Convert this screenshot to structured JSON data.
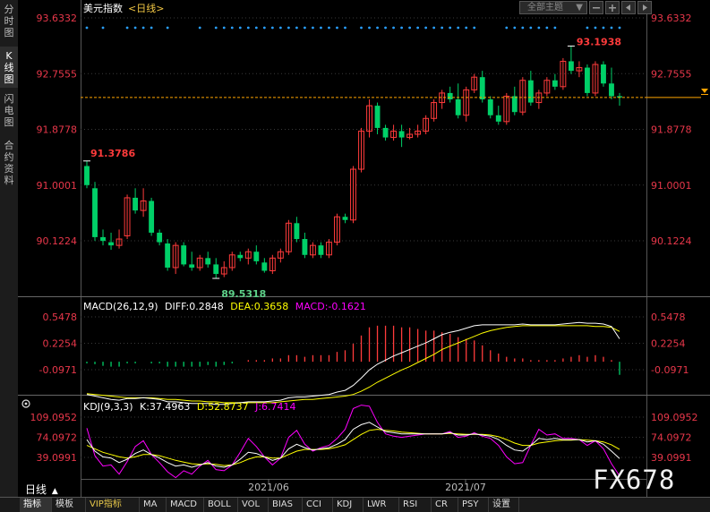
{
  "sidebar": {
    "items": [
      {
        "label": "分时图",
        "chars": [
          "分",
          "时",
          "图"
        ],
        "active": false
      },
      {
        "label": "K线图",
        "chars": [
          "K",
          "线",
          "图"
        ],
        "active": true
      },
      {
        "label": "闪电图",
        "chars": [
          "闪",
          "电",
          "图"
        ],
        "active": false
      },
      {
        "label": "合约资料",
        "chars": [
          "合",
          "约",
          "资",
          "料"
        ],
        "active": false
      }
    ]
  },
  "header": {
    "title": "美元指数",
    "period": "<日线>",
    "theme_select": "全部主题",
    "theme_arrow": "▼"
  },
  "colors": {
    "up": "#ff3b3b",
    "down": "#00d068",
    "axis_text": "#e8374a",
    "grid": "#444",
    "macd_axis_text": "#e8374a",
    "diff_line": "#ffffff",
    "dea_line": "#ffff00",
    "kdj_k": "#ffffff",
    "kdj_d": "#ffff00",
    "kdj_j": "#ff00ff",
    "dot_marks": "#2aa0ff",
    "price_line": "#ffa500"
  },
  "chart_data": [
    {
      "type": "candlestick",
      "title": "美元指数",
      "y_ticks": [
        "93.6332",
        "92.7555",
        "91.8778",
        "91.0001",
        "90.1224"
      ],
      "y_tick_values": [
        93.6332,
        92.7555,
        91.8778,
        91.0001,
        90.1224
      ],
      "ylim": [
        89.35,
        93.85
      ],
      "x_ticks": [
        "2021/06",
        "2021/07"
      ],
      "annotations": {
        "high_label": "93.1938",
        "low_label": "89.5318",
        "left_label": "91.3786"
      },
      "current_price": 92.38,
      "candles": [
        {
          "o": 91.3,
          "h": 91.38,
          "l": 90.95,
          "c": 91.0
        },
        {
          "o": 90.95,
          "h": 91.05,
          "l": 90.12,
          "c": 90.18
        },
        {
          "o": 90.18,
          "h": 90.3,
          "l": 90.05,
          "c": 90.12
        },
        {
          "o": 90.1,
          "h": 90.25,
          "l": 89.98,
          "c": 90.05
        },
        {
          "o": 90.05,
          "h": 90.3,
          "l": 90.0,
          "c": 90.15
        },
        {
          "o": 90.2,
          "h": 90.85,
          "l": 90.15,
          "c": 90.8
        },
        {
          "o": 90.8,
          "h": 90.95,
          "l": 90.55,
          "c": 90.6
        },
        {
          "o": 90.6,
          "h": 90.95,
          "l": 90.5,
          "c": 90.75
        },
        {
          "o": 90.75,
          "h": 90.8,
          "l": 90.2,
          "c": 90.25
        },
        {
          "o": 90.25,
          "h": 90.3,
          "l": 90.05,
          "c": 90.1
        },
        {
          "o": 90.08,
          "h": 90.15,
          "l": 89.65,
          "c": 89.7
        },
        {
          "o": 89.7,
          "h": 90.1,
          "l": 89.6,
          "c": 90.05
        },
        {
          "o": 90.05,
          "h": 90.1,
          "l": 89.72,
          "c": 89.75
        },
        {
          "o": 89.75,
          "h": 89.95,
          "l": 89.65,
          "c": 89.7
        },
        {
          "o": 89.7,
          "h": 89.9,
          "l": 89.65,
          "c": 89.85
        },
        {
          "o": 89.85,
          "h": 89.95,
          "l": 89.7,
          "c": 89.75
        },
        {
          "o": 89.75,
          "h": 89.85,
          "l": 89.53,
          "c": 89.6
        },
        {
          "o": 89.6,
          "h": 89.8,
          "l": 89.55,
          "c": 89.7
        },
        {
          "o": 89.7,
          "h": 89.95,
          "l": 89.65,
          "c": 89.9
        },
        {
          "o": 89.9,
          "h": 89.95,
          "l": 89.8,
          "c": 89.85
        },
        {
          "o": 89.85,
          "h": 90.0,
          "l": 89.75,
          "c": 89.95
        },
        {
          "o": 89.95,
          "h": 90.05,
          "l": 89.75,
          "c": 89.8
        },
        {
          "o": 89.78,
          "h": 89.85,
          "l": 89.62,
          "c": 89.65
        },
        {
          "o": 89.65,
          "h": 89.9,
          "l": 89.6,
          "c": 89.85
        },
        {
          "o": 89.85,
          "h": 90.0,
          "l": 89.78,
          "c": 89.95
        },
        {
          "o": 89.95,
          "h": 90.45,
          "l": 89.9,
          "c": 90.4
        },
        {
          "o": 90.4,
          "h": 90.5,
          "l": 90.1,
          "c": 90.15
        },
        {
          "o": 90.15,
          "h": 90.25,
          "l": 89.85,
          "c": 89.9
        },
        {
          "o": 89.9,
          "h": 90.1,
          "l": 89.85,
          "c": 90.05
        },
        {
          "o": 90.05,
          "h": 90.1,
          "l": 89.85,
          "c": 89.9
        },
        {
          "o": 89.9,
          "h": 90.15,
          "l": 89.85,
          "c": 90.1
        },
        {
          "o": 90.1,
          "h": 90.55,
          "l": 90.05,
          "c": 90.5
        },
        {
          "o": 90.5,
          "h": 90.55,
          "l": 90.4,
          "c": 90.45
        },
        {
          "o": 90.45,
          "h": 91.3,
          "l": 90.4,
          "c": 91.25
        },
        {
          "o": 91.25,
          "h": 91.9,
          "l": 91.2,
          "c": 91.85
        },
        {
          "o": 91.85,
          "h": 92.35,
          "l": 91.75,
          "c": 92.25
        },
        {
          "o": 92.25,
          "h": 92.3,
          "l": 91.8,
          "c": 91.9
        },
        {
          "o": 91.9,
          "h": 91.95,
          "l": 91.7,
          "c": 91.75
        },
        {
          "o": 91.75,
          "h": 91.95,
          "l": 91.7,
          "c": 91.85
        },
        {
          "o": 91.85,
          "h": 91.95,
          "l": 91.6,
          "c": 91.75
        },
        {
          "o": 91.75,
          "h": 91.9,
          "l": 91.72,
          "c": 91.8
        },
        {
          "o": 91.8,
          "h": 91.95,
          "l": 91.75,
          "c": 91.85
        },
        {
          "o": 91.85,
          "h": 92.1,
          "l": 91.8,
          "c": 92.05
        },
        {
          "o": 92.05,
          "h": 92.35,
          "l": 92.0,
          "c": 92.3
        },
        {
          "o": 92.3,
          "h": 92.5,
          "l": 92.2,
          "c": 92.45
        },
        {
          "o": 92.45,
          "h": 92.55,
          "l": 92.3,
          "c": 92.35
        },
        {
          "o": 92.35,
          "h": 92.6,
          "l": 92.05,
          "c": 92.1
        },
        {
          "o": 92.1,
          "h": 92.55,
          "l": 92.0,
          "c": 92.5
        },
        {
          "o": 92.5,
          "h": 92.75,
          "l": 92.45,
          "c": 92.7
        },
        {
          "o": 92.7,
          "h": 92.8,
          "l": 92.3,
          "c": 92.35
        },
        {
          "o": 92.35,
          "h": 92.4,
          "l": 92.05,
          "c": 92.1
        },
        {
          "o": 92.1,
          "h": 92.25,
          "l": 91.95,
          "c": 92.0
        },
        {
          "o": 92.0,
          "h": 92.45,
          "l": 91.95,
          "c": 92.4
        },
        {
          "o": 92.4,
          "h": 92.55,
          "l": 92.1,
          "c": 92.15
        },
        {
          "o": 92.15,
          "h": 92.7,
          "l": 92.1,
          "c": 92.65
        },
        {
          "o": 92.65,
          "h": 92.8,
          "l": 92.25,
          "c": 92.3
        },
        {
          "o": 92.3,
          "h": 92.5,
          "l": 92.2,
          "c": 92.45
        },
        {
          "o": 92.45,
          "h": 92.7,
          "l": 92.4,
          "c": 92.65
        },
        {
          "o": 92.65,
          "h": 92.75,
          "l": 92.5,
          "c": 92.55
        },
        {
          "o": 92.55,
          "h": 93.0,
          "l": 92.5,
          "c": 92.95
        },
        {
          "o": 92.95,
          "h": 93.19,
          "l": 92.75,
          "c": 92.8
        },
        {
          "o": 92.8,
          "h": 92.95,
          "l": 92.7,
          "c": 92.85
        },
        {
          "o": 92.85,
          "h": 92.9,
          "l": 92.4,
          "c": 92.45
        },
        {
          "o": 92.45,
          "h": 92.95,
          "l": 92.4,
          "c": 92.9
        },
        {
          "o": 92.9,
          "h": 92.95,
          "l": 92.55,
          "c": 92.6
        },
        {
          "o": 92.6,
          "h": 92.85,
          "l": 92.35,
          "c": 92.4
        },
        {
          "o": 92.4,
          "h": 92.45,
          "l": 92.25,
          "c": 92.38
        }
      ]
    },
    {
      "type": "macd",
      "title": "MACD(26,12,9)",
      "legend": {
        "diff": "DIFF:0.2848",
        "dea": "DEA:0.3658",
        "macd": "MACD:-0.1621"
      },
      "y_ticks": [
        "0.5478",
        "0.2254",
        "-0.0971"
      ],
      "y_tick_values": [
        0.5478,
        0.2254,
        -0.0971
      ],
      "ylim": [
        -0.2,
        0.65
      ],
      "diff": [
        -0.4,
        -0.42,
        -0.44,
        -0.46,
        -0.47,
        -0.45,
        -0.45,
        -0.44,
        -0.45,
        -0.46,
        -0.49,
        -0.49,
        -0.5,
        -0.51,
        -0.51,
        -0.51,
        -0.52,
        -0.52,
        -0.51,
        -0.5,
        -0.49,
        -0.49,
        -0.49,
        -0.48,
        -0.47,
        -0.44,
        -0.43,
        -0.43,
        -0.42,
        -0.41,
        -0.4,
        -0.37,
        -0.35,
        -0.29,
        -0.2,
        -0.1,
        -0.03,
        0.02,
        0.07,
        0.11,
        0.15,
        0.19,
        0.23,
        0.28,
        0.33,
        0.36,
        0.38,
        0.41,
        0.44,
        0.45,
        0.45,
        0.45,
        0.45,
        0.45,
        0.46,
        0.45,
        0.45,
        0.45,
        0.45,
        0.46,
        0.47,
        0.48,
        0.47,
        0.47,
        0.46,
        0.43,
        0.28
      ],
      "dea": [
        -0.39,
        -0.4,
        -0.41,
        -0.42,
        -0.43,
        -0.44,
        -0.44,
        -0.44,
        -0.44,
        -0.45,
        -0.46,
        -0.46,
        -0.47,
        -0.48,
        -0.48,
        -0.49,
        -0.49,
        -0.5,
        -0.5,
        -0.5,
        -0.5,
        -0.5,
        -0.5,
        -0.5,
        -0.49,
        -0.48,
        -0.47,
        -0.46,
        -0.46,
        -0.45,
        -0.44,
        -0.43,
        -0.42,
        -0.4,
        -0.36,
        -0.31,
        -0.25,
        -0.2,
        -0.15,
        -0.1,
        -0.06,
        -0.01,
        0.04,
        0.09,
        0.15,
        0.19,
        0.23,
        0.27,
        0.31,
        0.35,
        0.38,
        0.4,
        0.42,
        0.43,
        0.44,
        0.44,
        0.44,
        0.44,
        0.44,
        0.44,
        0.44,
        0.44,
        0.44,
        0.43,
        0.43,
        0.42,
        0.37
      ],
      "hist": [
        -0.02,
        -0.03,
        -0.05,
        -0.06,
        -0.06,
        -0.02,
        -0.02,
        0.0,
        -0.02,
        -0.02,
        -0.06,
        -0.06,
        -0.06,
        -0.06,
        -0.06,
        -0.04,
        -0.06,
        -0.04,
        -0.02,
        0.0,
        0.02,
        0.02,
        0.02,
        0.04,
        0.04,
        0.08,
        0.08,
        0.06,
        0.08,
        0.08,
        0.08,
        0.12,
        0.14,
        0.22,
        0.32,
        0.42,
        0.44,
        0.44,
        0.44,
        0.42,
        0.42,
        0.4,
        0.38,
        0.38,
        0.36,
        0.34,
        0.3,
        0.28,
        0.26,
        0.2,
        0.14,
        0.1,
        0.06,
        0.04,
        0.04,
        0.02,
        0.02,
        0.02,
        0.02,
        0.04,
        0.06,
        0.08,
        0.06,
        0.08,
        0.06,
        0.02,
        -0.16
      ]
    },
    {
      "type": "kdj",
      "title": "KDJ(9,3,3)",
      "legend": {
        "k": "K:37.4963",
        "d": "D:52.8737",
        "j": "J:6.7414"
      },
      "y_ticks": [
        "109.0952",
        "74.0972",
        "39.0991"
      ],
      "y_tick_values": [
        109.0952,
        74.0972,
        39.0991
      ],
      "ylim": [
        0,
        125
      ],
      "k": [
        70,
        50,
        40,
        38,
        30,
        36,
        46,
        52,
        44,
        38,
        30,
        24,
        26,
        22,
        26,
        30,
        24,
        22,
        26,
        36,
        48,
        46,
        40,
        34,
        38,
        54,
        62,
        56,
        52,
        54,
        56,
        62,
        70,
        88,
        96,
        100,
        92,
        84,
        82,
        80,
        80,
        80,
        80,
        80,
        80,
        82,
        78,
        78,
        80,
        78,
        76,
        70,
        60,
        52,
        50,
        60,
        72,
        70,
        72,
        70,
        70,
        70,
        66,
        68,
        62,
        50,
        37
      ],
      "d": [
        60,
        54,
        48,
        44,
        40,
        38,
        40,
        44,
        44,
        42,
        38,
        34,
        31,
        28,
        27,
        28,
        27,
        25,
        26,
        30,
        36,
        40,
        40,
        38,
        38,
        44,
        50,
        53,
        53,
        53,
        54,
        57,
        61,
        70,
        79,
        86,
        88,
        86,
        85,
        83,
        82,
        81,
        80,
        80,
        80,
        81,
        80,
        79,
        79,
        79,
        78,
        75,
        70,
        64,
        60,
        60,
        64,
        66,
        68,
        69,
        69,
        70,
        69,
        68,
        66,
        61,
        53
      ],
      "j": [
        90,
        42,
        24,
        26,
        10,
        32,
        58,
        68,
        44,
        30,
        14,
        4,
        16,
        10,
        24,
        34,
        18,
        16,
        26,
        48,
        72,
        58,
        40,
        26,
        38,
        74,
        86,
        62,
        50,
        56,
        60,
        72,
        88,
        124,
        130,
        128,
        100,
        80,
        76,
        74,
        76,
        78,
        80,
        80,
        80,
        84,
        74,
        76,
        82,
        76,
        72,
        60,
        40,
        28,
        30,
        60,
        88,
        78,
        80,
        72,
        72,
        70,
        60,
        68,
        54,
        28,
        7
      ]
    }
  ],
  "bottom_tabs": [
    "指标",
    "模板",
    "VIP指标",
    "MA",
    "MACD",
    "BOLL",
    "VOL",
    "BIAS",
    "CCI",
    "KDJ",
    "LWR",
    "RSI",
    "CR",
    "PSY",
    "设置"
  ],
  "period_label": "日线",
  "period_arrow": "▲",
  "watermark": "FX678"
}
